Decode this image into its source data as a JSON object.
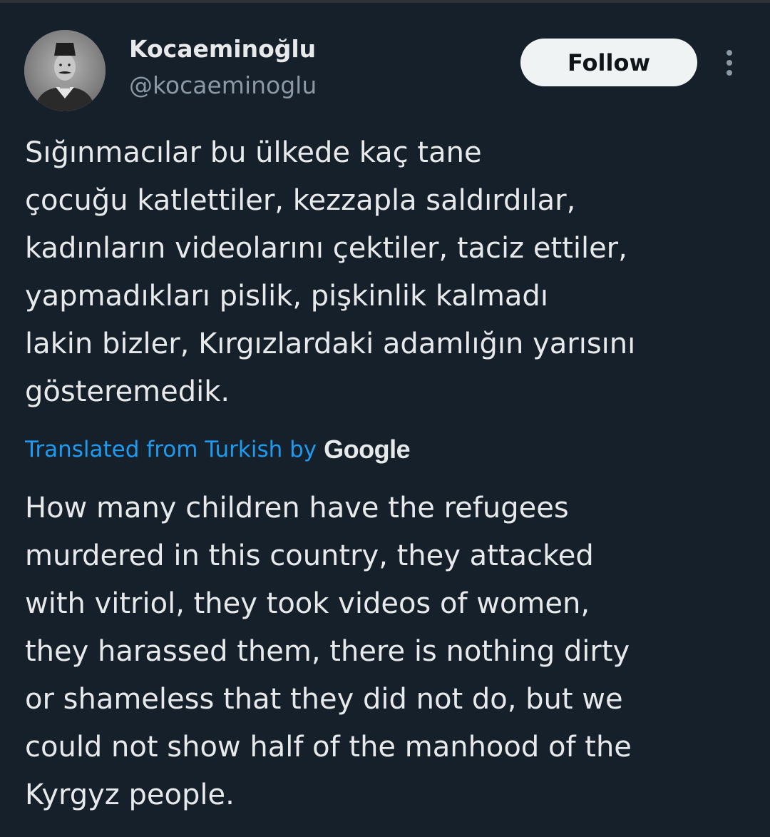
{
  "author": {
    "display_name": "Kocaeminoğlu",
    "handle": "@kocaeminoglu",
    "avatar_icon": "portrait-avatar-icon"
  },
  "actions": {
    "follow_label": "Follow",
    "more_icon": "more-options-icon"
  },
  "tweet": {
    "original_lines": [
      "Sığınmacılar bu ülkede kaç tane",
      "çocuğu katlettiler, kezzapla saldırdılar,",
      "kadınların videolarını çektiler, taciz ettiler,",
      "yapmadıkları pislik, pişkinlik kalmadı",
      "lakin bizler, Kırgızlardaki adamlığın yarısını",
      "gösteremedik."
    ],
    "translation_label": "Translated from Turkish by",
    "translation_provider": "Google",
    "translated_lines": [
      "How many children have the refugees",
      "murdered in this country, they attacked",
      "with vitriol, they took videos of women,",
      "they harassed them, there is nothing dirty",
      "or shameless that they did not do, but we",
      "could not show half of the manhood of the",
      "Kyrgyz people."
    ]
  },
  "colors": {
    "background": "#15202b",
    "text_primary": "#e7e9ea",
    "text_secondary": "#8b98a5",
    "link": "#1d9bf0",
    "follow_bg": "#eff3f4"
  }
}
